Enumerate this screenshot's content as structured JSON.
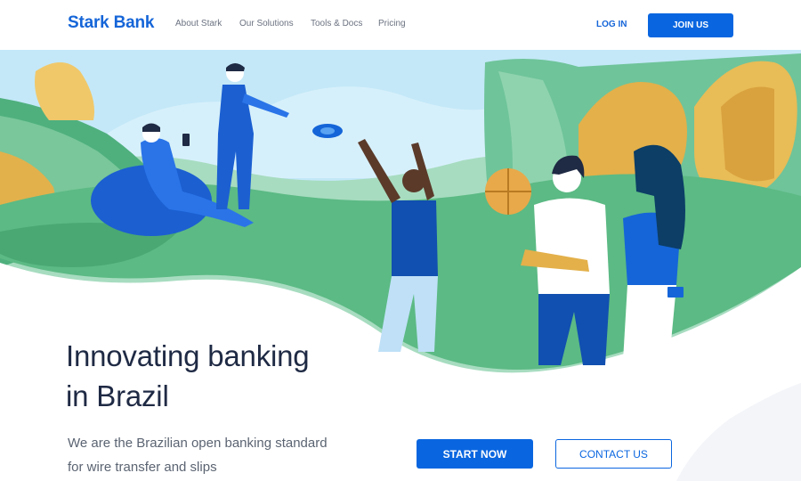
{
  "header": {
    "logo": "Stark Bank",
    "nav": [
      {
        "label": "About Stark"
      },
      {
        "label": "Our Solutions"
      },
      {
        "label": "Tools & Docs"
      },
      {
        "label": "Pricing"
      }
    ],
    "login_label": "LOG IN",
    "join_label": "JOIN US"
  },
  "hero": {
    "headline_line1": "Innovating banking",
    "headline_line2": "in Brazil",
    "sub_line1": "We are the Brazilian open banking standard",
    "sub_line2": "for wire transfer and slips",
    "start_label": "START NOW",
    "contact_label": "CONTACT US",
    "illustration": "people-playing-in-park-illustration"
  },
  "colors": {
    "brand_blue": "#0a66e0",
    "text_dark": "#1f2a44",
    "text_muted": "#5b6472",
    "grass_green": "#5fbf8a",
    "sky": "#bfe6f8",
    "leaf_gold": "#e6b54a"
  }
}
